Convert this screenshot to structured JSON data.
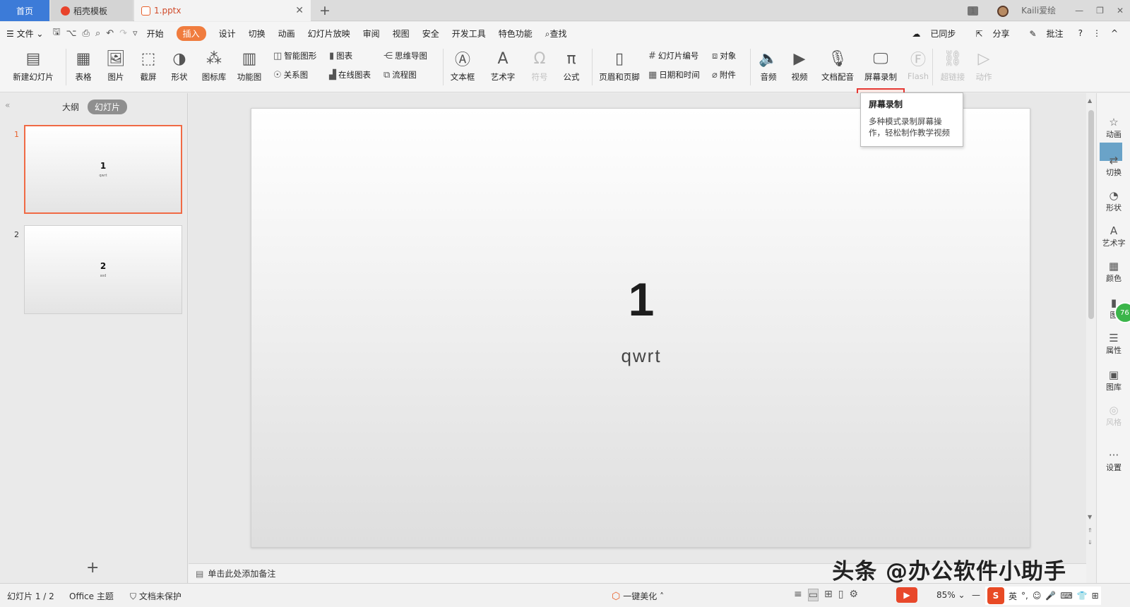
{
  "titlebar": {
    "tabs": [
      {
        "label": "首页"
      },
      {
        "label": "稻壳模板"
      },
      {
        "label": "1.pptx"
      }
    ],
    "badge": "1",
    "user": "Kaili爱绘",
    "close_icon": "close-icon",
    "add_icon": "plus-icon"
  },
  "menubar": {
    "file": "文件",
    "items": [
      "开始",
      "插入",
      "设计",
      "切换",
      "动画",
      "幻灯片放映",
      "审阅",
      "视图",
      "安全",
      "开发工具",
      "特色功能"
    ],
    "active": "插入",
    "search": "查找",
    "sync": "已同步",
    "share": "分享",
    "comment": "批注",
    "help": "?",
    "more": "⋮",
    "collapse": "^"
  },
  "ribbon": {
    "new_slide": "新建幻灯片",
    "table": "表格",
    "image": "图片",
    "screenshot": "截屏",
    "shape": "形状",
    "icon_lib": "图标库",
    "func_chart": "功能图",
    "smart_art": "智能图形",
    "chart": "图表",
    "relation": "关系图",
    "online_chart": "在线图表",
    "mindmap": "思维导图",
    "flowchart": "流程图",
    "textbox": "文本框",
    "wordart": "艺术字",
    "symbol": "符号",
    "formula": "公式",
    "header_footer": "页眉和页脚",
    "slide_number": "幻灯片编号",
    "object": "对象",
    "date_time": "日期和时间",
    "attachment": "附件",
    "audio": "音频",
    "video": "视频",
    "doc_voice": "文档配音",
    "screen_record": "屏幕录制",
    "flash": "Flash",
    "hyperlink": "超链接",
    "action": "动作"
  },
  "tooltip": {
    "title": "屏幕录制",
    "body": "多种模式录制屏幕操作，轻松制作教学视频"
  },
  "leftpanel": {
    "outline_tab": "大纲",
    "slides_tab": "幻灯片",
    "thumbs": [
      {
        "num": "1",
        "title": "1",
        "sub": "qwrt"
      },
      {
        "num": "2",
        "title": "2",
        "sub": "asd"
      }
    ]
  },
  "slide": {
    "title": "1",
    "subtitle": "qwrt"
  },
  "notes": {
    "placeholder": "单击此处添加备注",
    "watermark": "头条 @办公软件小助手"
  },
  "rightbar": {
    "items": [
      "动画",
      "切换",
      "形状",
      "艺术字",
      "颜色",
      "图",
      "属性",
      "图库",
      "风格",
      "设置"
    ],
    "badge": "76"
  },
  "statusbar": {
    "slide_info": "幻灯片 1 / 2",
    "theme": "Office 主题",
    "protect": "文档未保护",
    "beautify": "一键美化",
    "zoom": "85%",
    "ime_lang": "英"
  }
}
